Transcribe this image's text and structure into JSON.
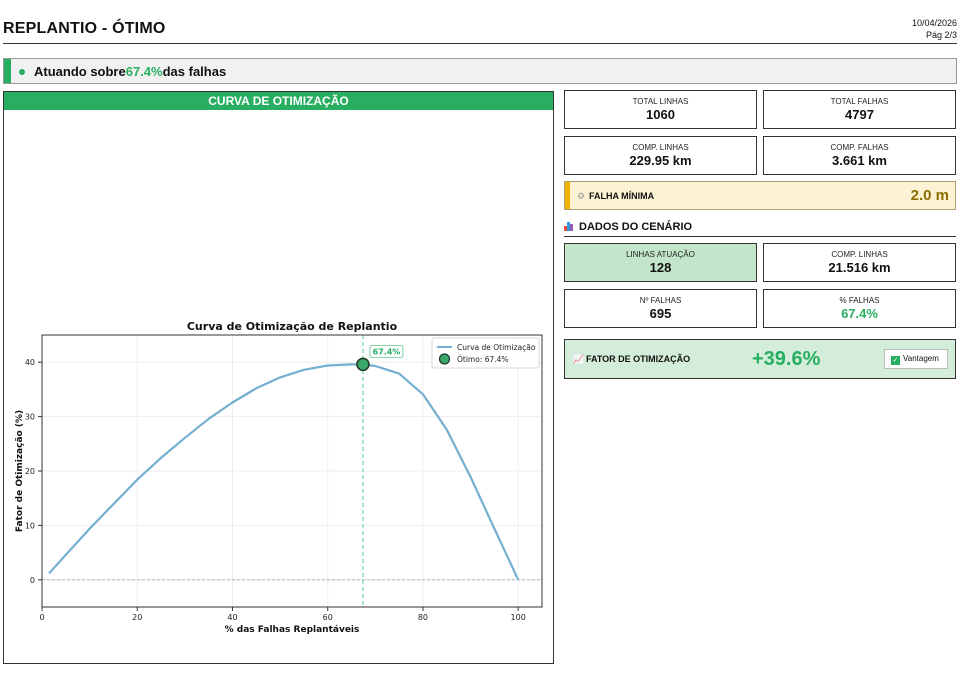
{
  "header": {
    "title": "REPLANTIO - ÓTIMO",
    "date": "10/04/2026",
    "page": "Pág 2/3"
  },
  "banner": {
    "prefix": "Atuando sobre",
    "percent": "67.4%",
    "suffix": "das falhas"
  },
  "chart_panel": {
    "header": "CURVA DE OTIMIZAÇÃO"
  },
  "stats": {
    "total_linhas": {
      "label": "TOTAL LINHAS",
      "value": "1060"
    },
    "total_falhas": {
      "label": "TOTAL FALHAS",
      "value": "4797"
    },
    "comp_linhas": {
      "label": "COMP. LINHAS",
      "value": "229.95 km"
    },
    "comp_falhas": {
      "label": "COMP. FALHAS",
      "value": "3.661 km"
    }
  },
  "falha_minima": {
    "icon": "gear-icon",
    "label": "FALHA MÍNIMA",
    "value": "2.0 m"
  },
  "scenario": {
    "title": "DADOS DO CENÁRIO",
    "icon": "bar-chart-icon",
    "linhas_atuacao": {
      "label": "LINHAS ATUAÇÃO",
      "value": "128"
    },
    "comp_linhas": {
      "label": "COMP. LINHAS",
      "value": "21.516 km"
    },
    "n_falhas": {
      "label": "Nº FALHAS",
      "value": "695"
    },
    "pct_falhas": {
      "label": "% FALHAS",
      "value": "67.4%"
    }
  },
  "fator": {
    "icon": "trend-up-icon",
    "label": "FATOR DE OTIMIZAÇÃO",
    "value": "+39.6%",
    "badge": "Vantagem"
  },
  "colors": {
    "accent": "#27ae60",
    "curve": "#74aed0",
    "warning": "#f0b400"
  },
  "chart_data": {
    "type": "line",
    "title": "Curva de Otimização de Replantio",
    "xlabel": "% das Falhas Replantáveis",
    "ylabel": "Fator de Otimização (%)",
    "xlim": [
      0,
      105
    ],
    "ylim": [
      -5,
      45
    ],
    "xticks": [
      0,
      20,
      40,
      60,
      80,
      100
    ],
    "yticks": [
      0,
      10,
      20,
      30,
      40
    ],
    "grid": true,
    "legend_position": "top-right",
    "series": [
      {
        "name": "Curva de Otimização",
        "x": [
          1.5,
          5,
          10,
          15,
          20,
          25,
          30,
          35,
          40,
          45,
          50,
          55,
          60,
          65,
          67.4,
          70,
          75,
          80,
          85,
          90,
          95,
          100
        ],
        "y": [
          1.2,
          4.6,
          9.4,
          13.9,
          18.4,
          22.4,
          26.1,
          29.6,
          32.6,
          35.2,
          37.2,
          38.6,
          39.4,
          39.6,
          39.6,
          39.3,
          37.9,
          34.1,
          27.6,
          18.9,
          9.4,
          0.0
        ]
      }
    ],
    "optimum": {
      "label": "Ótimo: 67.4%",
      "x": 67.4,
      "y": 39.6,
      "annotation": "67.4%"
    }
  }
}
